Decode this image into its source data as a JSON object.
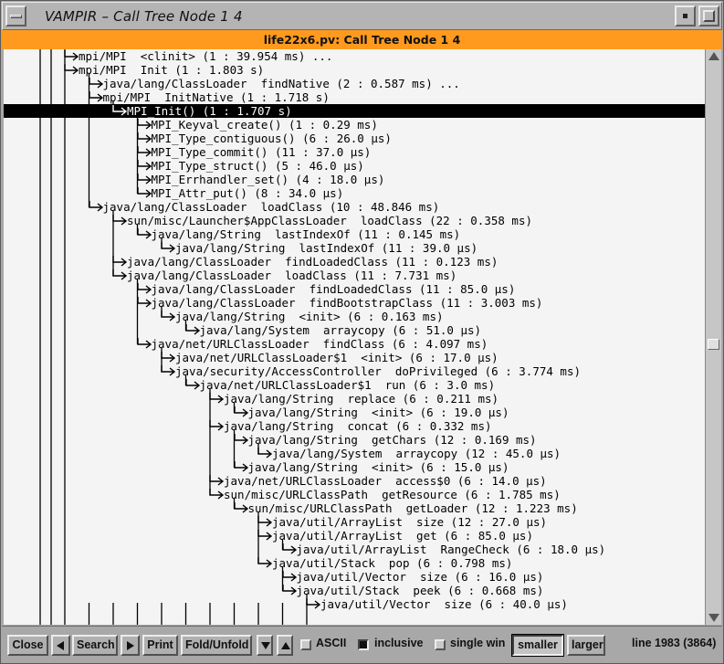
{
  "window": {
    "title": "VAMPIR – Call Tree Node 1 4",
    "header": "life22x6.pv: Call Tree Node 1 4"
  },
  "tree": {
    "rows": [
      {
        "depth": 0,
        "text": "mpi/MPI  <clinit> (1 : 39.954 ms) ..."
      },
      {
        "depth": 0,
        "text": "mpi/MPI  Init (1 : 1.803 s)"
      },
      {
        "depth": 1,
        "text": "java/lang/ClassLoader  findNative (2 : 0.587 ms) ..."
      },
      {
        "depth": 1,
        "text": "mpi/MPI  InitNative (1 : 1.718 s)"
      },
      {
        "depth": 2,
        "text": "MPI_Init() (1 : 1.707 s)",
        "selected": true
      },
      {
        "depth": 3,
        "text": "MPI_Keyval_create() (1 : 0.29 ms)"
      },
      {
        "depth": 3,
        "text": "MPI_Type_contiguous() (6 : 26.0 µs)"
      },
      {
        "depth": 3,
        "text": "MPI_Type_commit() (11 : 37.0 µs)"
      },
      {
        "depth": 3,
        "text": "MPI_Type_struct() (5 : 46.0 µs)"
      },
      {
        "depth": 3,
        "text": "MPI_Errhandler_set() (4 : 18.0 µs)"
      },
      {
        "depth": 3,
        "text": "MPI_Attr_put() (8 : 34.0 µs)"
      },
      {
        "depth": 1,
        "text": "java/lang/ClassLoader  loadClass (10 : 48.846 ms)"
      },
      {
        "depth": 2,
        "text": "sun/misc/Launcher$AppClassLoader  loadClass (22 : 0.358 ms)"
      },
      {
        "depth": 3,
        "text": "java/lang/String  lastIndexOf (11 : 0.145 ms)"
      },
      {
        "depth": 4,
        "text": "java/lang/String  lastIndexOf (11 : 39.0 µs)"
      },
      {
        "depth": 2,
        "text": "java/lang/ClassLoader  findLoadedClass (11 : 0.123 ms)"
      },
      {
        "depth": 2,
        "text": "java/lang/ClassLoader  loadClass (11 : 7.731 ms)"
      },
      {
        "depth": 3,
        "text": "java/lang/ClassLoader  findLoadedClass (11 : 85.0 µs)"
      },
      {
        "depth": 3,
        "text": "java/lang/ClassLoader  findBootstrapClass (11 : 3.003 ms)"
      },
      {
        "depth": 4,
        "text": "java/lang/String  <init> (6 : 0.163 ms)"
      },
      {
        "depth": 5,
        "text": "java/lang/System  arraycopy (6 : 51.0 µs)"
      },
      {
        "depth": 3,
        "text": "java/net/URLClassLoader  findClass (6 : 4.097 ms)"
      },
      {
        "depth": 4,
        "text": "java/net/URLClassLoader$1  <init> (6 : 17.0 µs)"
      },
      {
        "depth": 4,
        "text": "java/security/AccessController  doPrivileged (6 : 3.774 ms)"
      },
      {
        "depth": 5,
        "text": "java/net/URLClassLoader$1  run (6 : 3.0 ms)"
      },
      {
        "depth": 6,
        "text": "java/lang/String  replace (6 : 0.211 ms)"
      },
      {
        "depth": 7,
        "text": "java/lang/String  <init> (6 : 19.0 µs)"
      },
      {
        "depth": 6,
        "text": "java/lang/String  concat (6 : 0.332 ms)"
      },
      {
        "depth": 7,
        "text": "java/lang/String  getChars (12 : 0.169 ms)"
      },
      {
        "depth": 8,
        "text": "java/lang/System  arraycopy (12 : 45.0 µs)"
      },
      {
        "depth": 7,
        "text": "java/lang/String  <init> (6 : 15.0 µs)"
      },
      {
        "depth": 6,
        "text": "java/net/URLClassLoader  access$0 (6 : 14.0 µs)"
      },
      {
        "depth": 6,
        "text": "sun/misc/URLClassPath  getResource (6 : 1.785 ms)"
      },
      {
        "depth": 7,
        "text": "sun/misc/URLClassPath  getLoader (12 : 1.223 ms)"
      },
      {
        "depth": 8,
        "text": "java/util/ArrayList  size (12 : 27.0 µs)"
      },
      {
        "depth": 8,
        "text": "java/util/ArrayList  get (6 : 85.0 µs)"
      },
      {
        "depth": 9,
        "text": "java/util/ArrayList  RangeCheck (6 : 18.0 µs)"
      },
      {
        "depth": 8,
        "text": "java/util/Stack  pop (6 : 0.798 ms)"
      },
      {
        "depth": 9,
        "text": "java/util/Vector  size (6 : 16.0 µs)"
      },
      {
        "depth": 9,
        "text": "java/util/Stack  peek (6 : 0.668 ms)"
      },
      {
        "depth": 10,
        "text": "java/util/Vector  size (6 : 40.0 µs)"
      }
    ]
  },
  "toolbar": {
    "close": "Close",
    "search": "Search",
    "print": "Print",
    "fold": "Fold/Unfold",
    "ascii": "ASCII",
    "ascii_checked": false,
    "inclusive": "inclusive",
    "inclusive_checked": true,
    "single_win": "single win",
    "single_win_checked": false,
    "smaller": "smaller",
    "larger": "larger",
    "status": "line 1983 (3864)"
  },
  "icons": {
    "menu": "window-menu-icon",
    "minimize": "minimize-icon",
    "maximize": "maximize-icon",
    "prev": "triangle-left-icon",
    "next": "triangle-right-icon",
    "down": "triangle-down-icon",
    "up": "triangle-up-icon"
  },
  "colors": {
    "header_bg": "#ff9a1e",
    "tree_bg": "#f4f4f4",
    "selection_bg": "#000000",
    "selection_fg": "#ffffff"
  }
}
